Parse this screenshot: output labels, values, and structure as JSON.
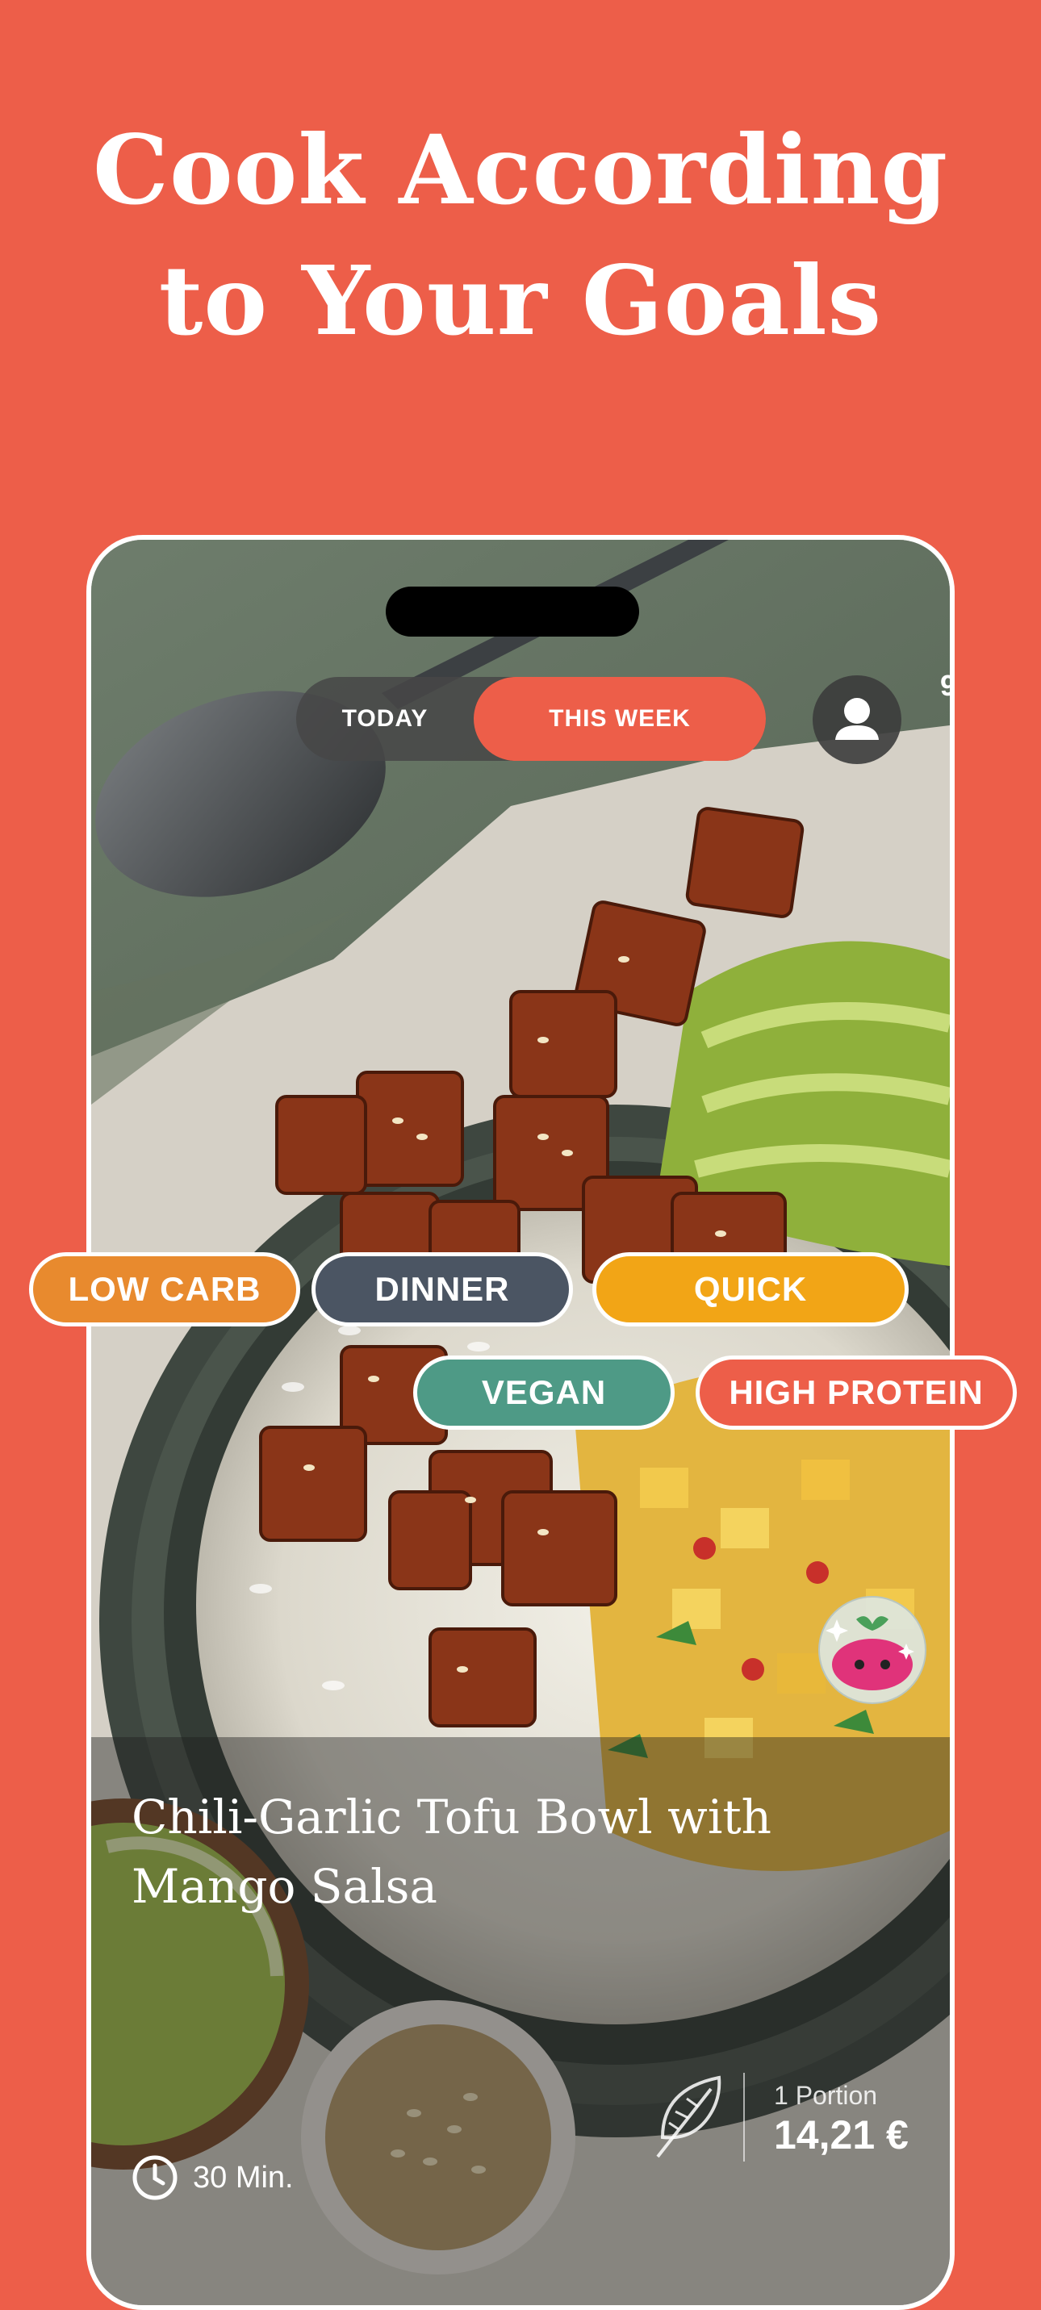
{
  "headline": {
    "line1": "Cook According",
    "line2": "to Your Goals"
  },
  "colors": {
    "background": "#ED5E49",
    "accent": "#ED5E49",
    "tag_low_carb": "#E88A2E",
    "tag_dinner": "#4B5563",
    "tag_quick": "#F2A516",
    "tag_vegan": "#4E9A86",
    "tag_high_protein": "#ED5E49"
  },
  "segmented_control": {
    "today": "TODAY",
    "this_week": "THIS WEEK",
    "selected": "THIS WEEK"
  },
  "partial_edge_text": "9",
  "tags": [
    "LOW CARB",
    "DINNER",
    "QUICK",
    "VEGAN",
    "HIGH PROTEIN"
  ],
  "recipe": {
    "title": "Chili-Garlic Tofu Bowl with Mango Salsa",
    "time": "30 Min.",
    "portion_label": "1 Portion",
    "price": "14,21 €"
  },
  "icons": [
    "user-icon",
    "clock-icon",
    "leaf-icon",
    "mascot-icon"
  ]
}
